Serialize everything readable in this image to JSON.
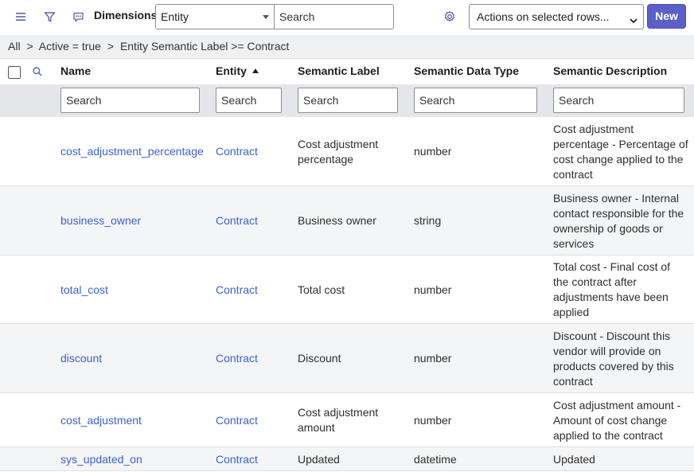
{
  "header": {
    "title": "Dimensions",
    "entity_select_value": "Entity",
    "search_placeholder": "Search",
    "actions_select_value": "Actions on selected rows...",
    "new_button": "New",
    "accent_color": "#5b5fc7",
    "icons": [
      "hamburger-menu-icon",
      "filter-icon",
      "chat-bubble-icon",
      "gear-icon"
    ]
  },
  "breadcrumb": [
    "All",
    ">",
    "Active = true",
    ">",
    "Entity Semantic Label >= Contract"
  ],
  "table": {
    "columns": [
      "Name",
      "Entity",
      "Semantic Label",
      "Semantic Data Type",
      "Semantic Description"
    ],
    "sorted_column": "Entity",
    "sort_direction": "ascending",
    "filter_placeholder": "Search",
    "rows": [
      {
        "name": "cost_adjustment_percentage",
        "entity": "Contract",
        "label": [
          "Cost adjustment",
          "percentage"
        ],
        "type": "number",
        "description": [
          "Cost adjustment",
          "percentage - Percentage of",
          "cost change applied to the",
          "contract"
        ]
      },
      {
        "name": "business_owner",
        "entity": "Contract",
        "label": [
          "Business owner"
        ],
        "type": "string",
        "description": [
          "Business owner - Internal",
          "contact responsible for the",
          "ownership of goods or",
          "services"
        ]
      },
      {
        "name": "total_cost",
        "entity": "Contract",
        "label": [
          "Total cost"
        ],
        "type": "number",
        "description": [
          "Total cost - Final cost of",
          "the contract after",
          "adjustments have been",
          "applied"
        ]
      },
      {
        "name": "discount",
        "entity": "Contract",
        "label": [
          "Discount"
        ],
        "type": "number",
        "description": [
          "Discount - Discount this",
          "vendor will provide on",
          "products covered by this",
          "contract"
        ]
      },
      {
        "name": "cost_adjustment",
        "entity": "Contract",
        "label": [
          "Cost adjustment",
          "amount"
        ],
        "type": "number",
        "description": [
          "Cost adjustment amount -",
          "Amount of cost change",
          "applied to the contract"
        ]
      },
      {
        "name": "sys_updated_on",
        "entity": "Contract",
        "label": [
          "Updated"
        ],
        "type": "datetime",
        "description": [
          "Updated"
        ]
      }
    ]
  }
}
